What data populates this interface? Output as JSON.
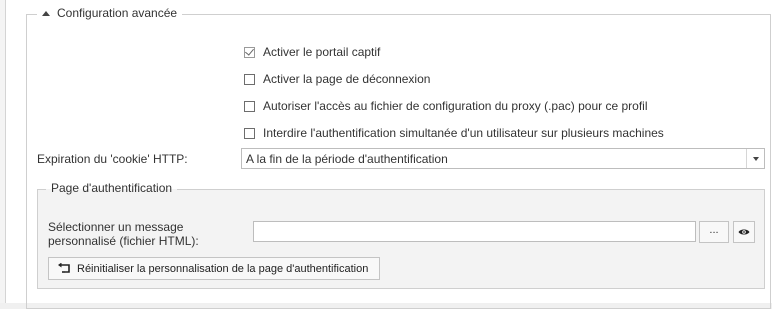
{
  "section": {
    "title": "Configuration avancée",
    "collapse_icon": "triangle-up-icon"
  },
  "options": [
    {
      "label": "Activer le portail captif",
      "checked": true
    },
    {
      "label": "Activer la page de déconnexion",
      "checked": false
    },
    {
      "label": "Autoriser l'accès au fichier de configuration du proxy (.pac) pour ce profil",
      "checked": false
    },
    {
      "label": "Interdire l'authentification simultanée d'un utilisateur sur plusieurs machines",
      "checked": false
    }
  ],
  "cookie": {
    "label": "Expiration du 'cookie' HTTP:",
    "value": "A la fin de la période d'authentification"
  },
  "auth_page": {
    "title": "Page d'authentification",
    "message_label_line1": "Sélectionner un message",
    "message_label_line2": "personnalisé (fichier HTML):",
    "file_value": "",
    "browse_label": "...",
    "preview_icon": "eye-icon",
    "reset_label": "Réinitialiser la personnalisation de la page d'authentification",
    "reset_icon": "reset-arrow-icon"
  }
}
